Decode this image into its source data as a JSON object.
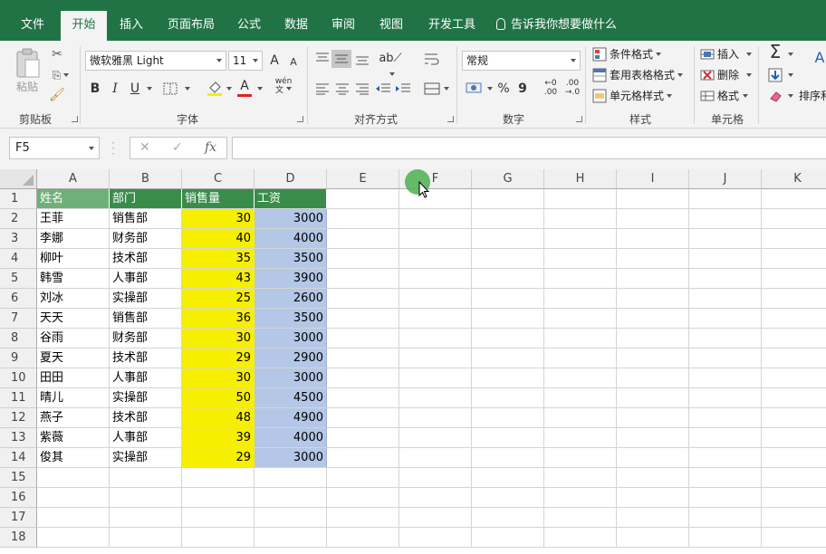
{
  "tabs": [
    "文件",
    "开始",
    "插入",
    "页面布局",
    "公式",
    "数据",
    "审阅",
    "视图",
    "开发工具"
  ],
  "active_tab": "开始",
  "tell_me": "告诉我你想要做什么",
  "ribbon": {
    "clipboard": {
      "paste": "粘贴",
      "label": "剪贴板"
    },
    "font": {
      "name": "微软雅黑 Light",
      "size": "11",
      "label": "字体",
      "bold": "B",
      "italic": "I",
      "underline": "U",
      "grow": "A",
      "shrink": "A",
      "fontcolor": "A",
      "phonetic": "wén"
    },
    "alignment": {
      "label": "对齐方式"
    },
    "number": {
      "format": "常规",
      "label": "数字",
      "percent": "%",
      "comma": "9"
    },
    "styles": {
      "conditional": "条件格式",
      "table": "套用表格格式",
      "cell": "单元格样式",
      "label": "样式"
    },
    "cells": {
      "insert": "插入",
      "delete": "删除",
      "format": "格式",
      "label": "单元格"
    },
    "editing": {
      "sort": "排序和"
    }
  },
  "formula_bar": {
    "name_box": "F5",
    "fx": "fx",
    "cancel": "✕",
    "enter": "✓",
    "value": ""
  },
  "sheet": {
    "columns": [
      "A",
      "B",
      "C",
      "D",
      "E",
      "F",
      "G",
      "H",
      "I",
      "J",
      "K"
    ],
    "rows": [
      "1",
      "2",
      "3",
      "4",
      "5",
      "6",
      "7",
      "8",
      "9",
      "10",
      "11",
      "12",
      "13",
      "14",
      "15",
      "16",
      "17",
      "18"
    ],
    "header": [
      "姓名",
      "部门",
      "销售量",
      "工资"
    ],
    "data": [
      [
        "王菲",
        "销售部",
        "30",
        "3000"
      ],
      [
        "李娜",
        "财务部",
        "40",
        "4000"
      ],
      [
        "柳叶",
        "技术部",
        "35",
        "3500"
      ],
      [
        "韩雪",
        "人事部",
        "43",
        "3900"
      ],
      [
        "刘冰",
        "实操部",
        "25",
        "2600"
      ],
      [
        "天天",
        "销售部",
        "36",
        "3500"
      ],
      [
        "谷雨",
        "财务部",
        "30",
        "3000"
      ],
      [
        "夏天",
        "技术部",
        "29",
        "2900"
      ],
      [
        "田田",
        "人事部",
        "30",
        "3000"
      ],
      [
        "晴儿",
        "实操部",
        "50",
        "4500"
      ],
      [
        "燕子",
        "技术部",
        "48",
        "4900"
      ],
      [
        "紫薇",
        "人事部",
        "39",
        "4000"
      ],
      [
        "俊其",
        "实操部",
        "29",
        "3000"
      ]
    ]
  },
  "colors": {
    "ribbon_green": "#217346",
    "header_fill": "#3a8c4a",
    "name_header_fill": "#6fb07a",
    "yellow_fill": "#f7ef00",
    "blue_fill": "#b4c7e7"
  }
}
